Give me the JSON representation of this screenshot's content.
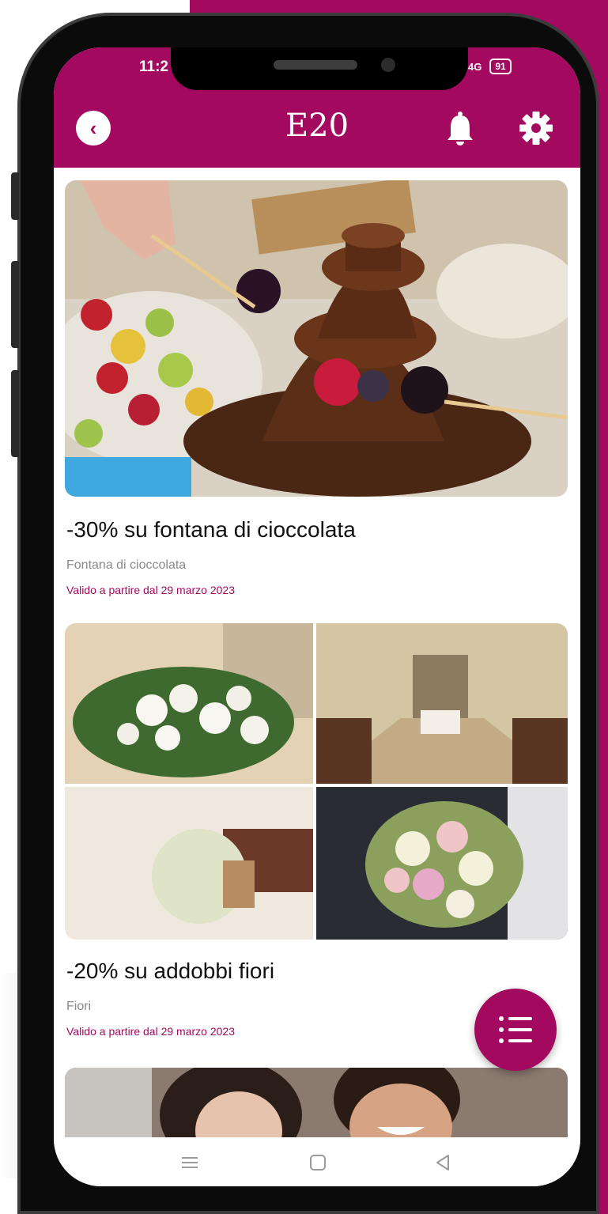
{
  "status_bar": {
    "time": "11:2",
    "network": "4G",
    "battery": "91"
  },
  "header": {
    "title": "E20",
    "back_icon": "chevron-left-icon",
    "notification_icon": "bell-icon",
    "settings_icon": "gear-icon"
  },
  "offers": [
    {
      "title": "-30% su fontana di cioccolata",
      "category": "Fontana di cioccolata",
      "validity": "Valido a partire dal 29 marzo 2023"
    },
    {
      "title": "-20% su addobbi fiori",
      "category": "Fiori",
      "validity": "Valido a partire dal 29 marzo 2023"
    }
  ],
  "fab": {
    "icon": "list-icon"
  },
  "navigation_bar": {
    "icons": [
      "menu-icon",
      "home-icon",
      "back-icon"
    ]
  },
  "colors": {
    "brand": "#a3095f",
    "background": "#ffffff"
  }
}
